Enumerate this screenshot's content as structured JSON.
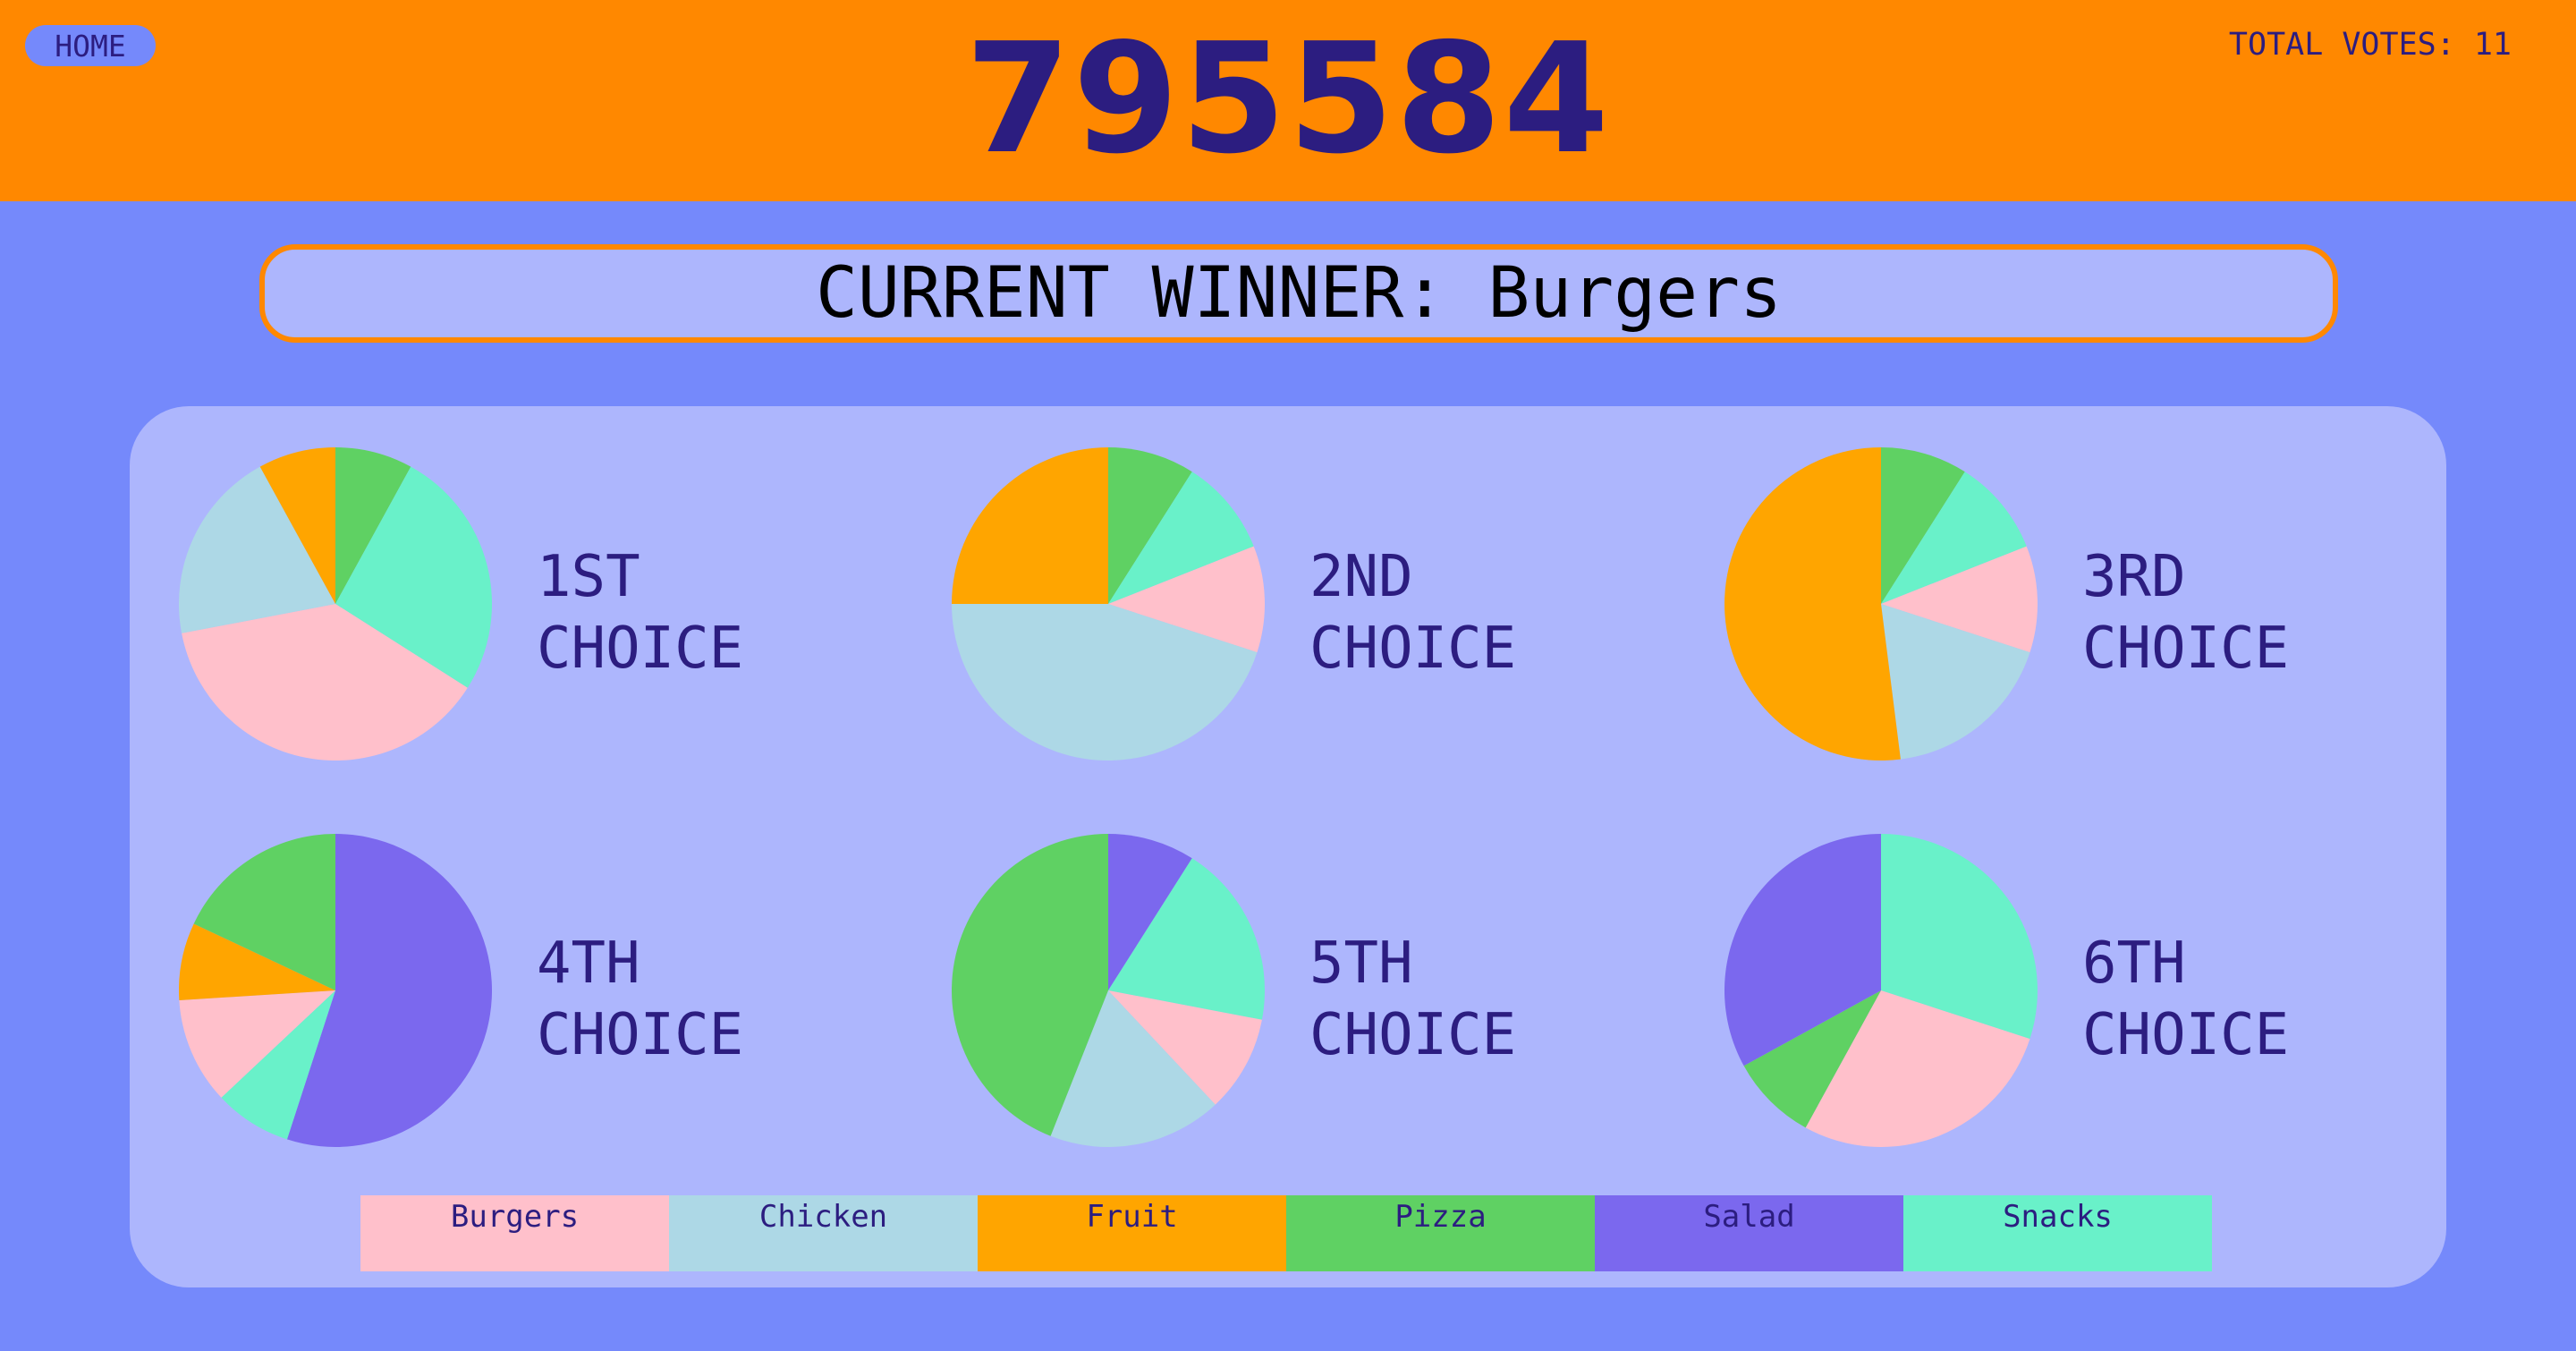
{
  "header": {
    "home_label": "HOME",
    "game_code": "795584",
    "total_votes": "TOTAL VOTES: 11"
  },
  "winner": {
    "text": "CURRENT WINNER: Burgers"
  },
  "colors": {
    "Burgers": "#ffc0cb",
    "Chicken": "#add8e6",
    "Fruit": "#ffa500",
    "Pizza": "#5fd163",
    "Salad": "#7b68ee",
    "Snacks": "#69f1c9"
  },
  "legend": [
    "Burgers",
    "Chicken",
    "Fruit",
    "Pizza",
    "Salad",
    "Snacks"
  ],
  "chart_data": [
    {
      "type": "pie",
      "label_line1": "1ST",
      "label_line2": "CHOICE",
      "slices": [
        {
          "name": "Pizza",
          "value": 8
        },
        {
          "name": "Snacks",
          "value": 26
        },
        {
          "name": "Burgers",
          "value": 38
        },
        {
          "name": "Chicken",
          "value": 20
        },
        {
          "name": "Fruit",
          "value": 8
        }
      ]
    },
    {
      "type": "pie",
      "label_line1": "2ND",
      "label_line2": "CHOICE",
      "slices": [
        {
          "name": "Pizza",
          "value": 9
        },
        {
          "name": "Snacks",
          "value": 10
        },
        {
          "name": "Burgers",
          "value": 11
        },
        {
          "name": "Chicken",
          "value": 45
        },
        {
          "name": "Fruit",
          "value": 25
        }
      ]
    },
    {
      "type": "pie",
      "label_line1": "3RD",
      "label_line2": "CHOICE",
      "slices": [
        {
          "name": "Pizza",
          "value": 9
        },
        {
          "name": "Snacks",
          "value": 10
        },
        {
          "name": "Burgers",
          "value": 11
        },
        {
          "name": "Chicken",
          "value": 18
        },
        {
          "name": "Fruit",
          "value": 52
        }
      ]
    },
    {
      "type": "pie",
      "label_line1": "4TH",
      "label_line2": "CHOICE",
      "slices": [
        {
          "name": "Salad",
          "value": 55
        },
        {
          "name": "Snacks",
          "value": 8
        },
        {
          "name": "Burgers",
          "value": 11
        },
        {
          "name": "Fruit",
          "value": 8
        },
        {
          "name": "Pizza",
          "value": 18
        }
      ]
    },
    {
      "type": "pie",
      "label_line1": "5TH",
      "label_line2": "CHOICE",
      "slices": [
        {
          "name": "Salad",
          "value": 9
        },
        {
          "name": "Snacks",
          "value": 19
        },
        {
          "name": "Burgers",
          "value": 10
        },
        {
          "name": "Chicken",
          "value": 18
        },
        {
          "name": "Pizza",
          "value": 44
        }
      ]
    },
    {
      "type": "pie",
      "label_line1": "6TH",
      "label_line2": "CHOICE",
      "slices": [
        {
          "name": "Snacks",
          "value": 30
        },
        {
          "name": "Burgers",
          "value": 28
        },
        {
          "name": "Pizza",
          "value": 9
        },
        {
          "name": "Salad",
          "value": 33
        }
      ]
    }
  ]
}
